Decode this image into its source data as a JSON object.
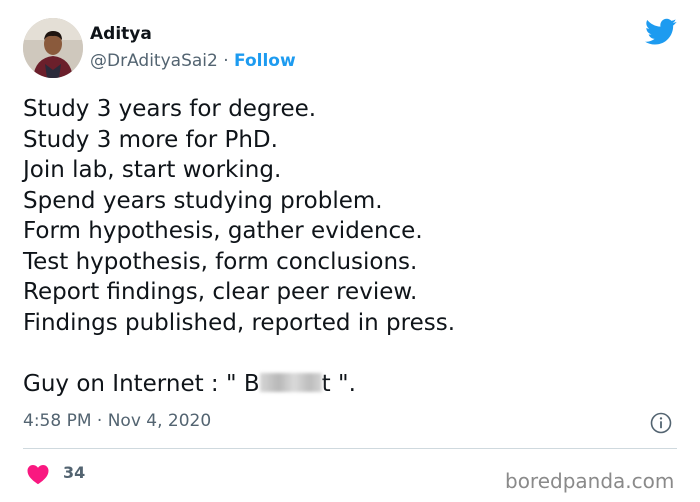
{
  "author": {
    "name": "Aditya",
    "handle": "@DrAdityaSai2",
    "separator": " · ",
    "follow_label": "Follow"
  },
  "tweet": {
    "lines": [
      "Study 3 years for degree.",
      "Study 3 more for PhD.",
      "Join lab, start working.",
      "Spend years studying problem.",
      "Form hypothesis, gather evidence.",
      "Test hypothesis, form conclusions.",
      "Report findings, clear peer review.",
      "Findings published, reported in press."
    ],
    "last_line_prefix": "Guy on Internet : \" B",
    "last_line_suffix": "t \"."
  },
  "meta": {
    "timestamp": "4:58 PM · Nov 4, 2020",
    "like_count": "34"
  },
  "icons": {
    "brand": "twitter-bird-icon",
    "info": "info-icon",
    "like": "heart-icon"
  },
  "colors": {
    "twitter_blue": "#1d9bf0",
    "heart_red": "#f91880",
    "secondary_text": "#536471"
  },
  "watermark": "boredpanda.com"
}
